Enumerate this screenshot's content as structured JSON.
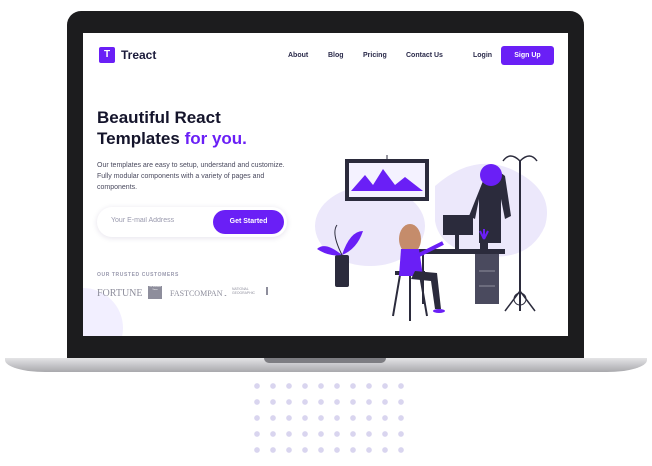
{
  "nav": {
    "logo_letter": "T",
    "brand": "Treact",
    "links": [
      "About",
      "Blog",
      "Pricing",
      "Contact Us",
      "Login"
    ],
    "signup": "Sign Up"
  },
  "hero": {
    "title_line1": "Beautiful React",
    "title_line2": "Templates",
    "title_accent": "for you.",
    "description": "Our templates are easy to setup, understand and customize. Fully modular components with a variety of pages and components.",
    "email_placeholder": "Your E-mail Address",
    "cta": "Get Started"
  },
  "customers": {
    "label": "OUR TRUSTED CUSTOMERS",
    "logos": [
      "FORTUNE",
      "The Business Times",
      "FASTCOMPANY",
      "NATIONAL GEOGRAPHIC"
    ]
  },
  "colors": {
    "accent": "#6a1ff6",
    "dark": "#14142b",
    "light_purple": "#ece8fb"
  },
  "icons": [
    "logo-icon",
    "illustration-woman-at-desk"
  ]
}
